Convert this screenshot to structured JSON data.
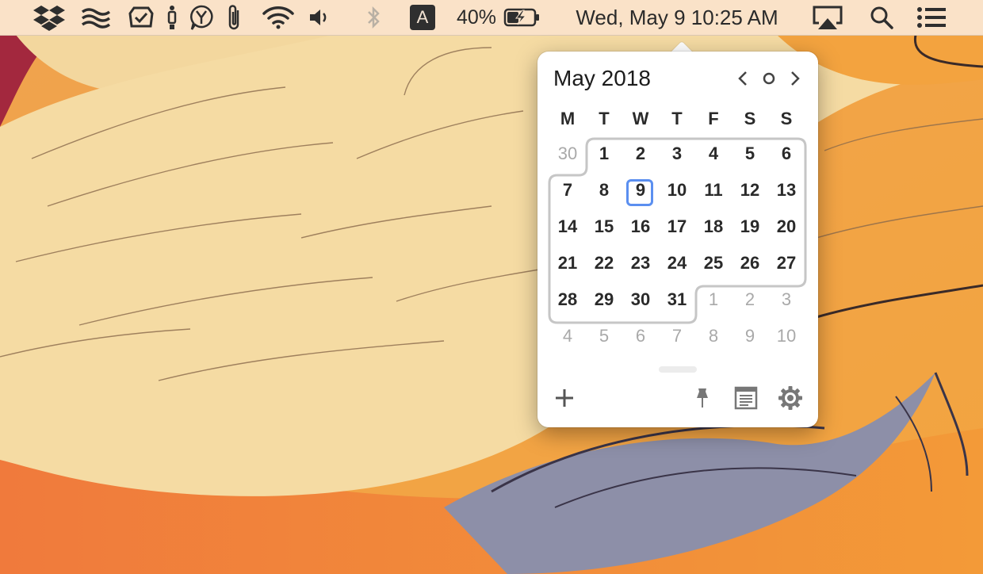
{
  "menubar": {
    "icons": [
      "dropbox-icon",
      "waves-icon",
      "checkmark-badge-icon",
      "figure-icon",
      "y-bubble-icon",
      "paperclip-icon",
      "wifi-icon",
      "volume-icon",
      "bluetooth-icon"
    ],
    "input_source": "A",
    "battery_percent": "40%",
    "clock": "Wed, May 9 10:25 AM",
    "right_icons": [
      "airplay-icon",
      "spotlight-search-icon",
      "notification-center-icon"
    ]
  },
  "calendar": {
    "month_title": "May 2018",
    "weekdays": [
      "M",
      "T",
      "W",
      "T",
      "F",
      "S",
      "S"
    ],
    "today": "9",
    "weeks": [
      [
        {
          "d": "30",
          "o": true
        },
        {
          "d": "1"
        },
        {
          "d": "2"
        },
        {
          "d": "3"
        },
        {
          "d": "4"
        },
        {
          "d": "5"
        },
        {
          "d": "6"
        }
      ],
      [
        {
          "d": "7"
        },
        {
          "d": "8"
        },
        {
          "d": "9"
        },
        {
          "d": "10"
        },
        {
          "d": "11"
        },
        {
          "d": "12"
        },
        {
          "d": "13"
        }
      ],
      [
        {
          "d": "14"
        },
        {
          "d": "15"
        },
        {
          "d": "16"
        },
        {
          "d": "17"
        },
        {
          "d": "18"
        },
        {
          "d": "19"
        },
        {
          "d": "20"
        }
      ],
      [
        {
          "d": "21"
        },
        {
          "d": "22"
        },
        {
          "d": "23"
        },
        {
          "d": "24"
        },
        {
          "d": "25"
        },
        {
          "d": "26"
        },
        {
          "d": "27"
        }
      ],
      [
        {
          "d": "28"
        },
        {
          "d": "29"
        },
        {
          "d": "30"
        },
        {
          "d": "31"
        },
        {
          "d": "1",
          "o": true
        },
        {
          "d": "2",
          "o": true
        },
        {
          "d": "3",
          "o": true
        }
      ],
      [
        {
          "d": "4",
          "o": true
        },
        {
          "d": "5",
          "o": true
        },
        {
          "d": "6",
          "o": true
        },
        {
          "d": "7",
          "o": true
        },
        {
          "d": "8",
          "o": true
        },
        {
          "d": "9",
          "o": true
        },
        {
          "d": "10",
          "o": true
        }
      ]
    ],
    "toolbar": [
      "add-event-icon",
      "pin-icon",
      "agenda-icon",
      "settings-gear-icon"
    ]
  },
  "colors": {
    "accent": "#5b8ff0",
    "menubar": "#fae4cd",
    "other_month_text": "#a9a9a9"
  }
}
